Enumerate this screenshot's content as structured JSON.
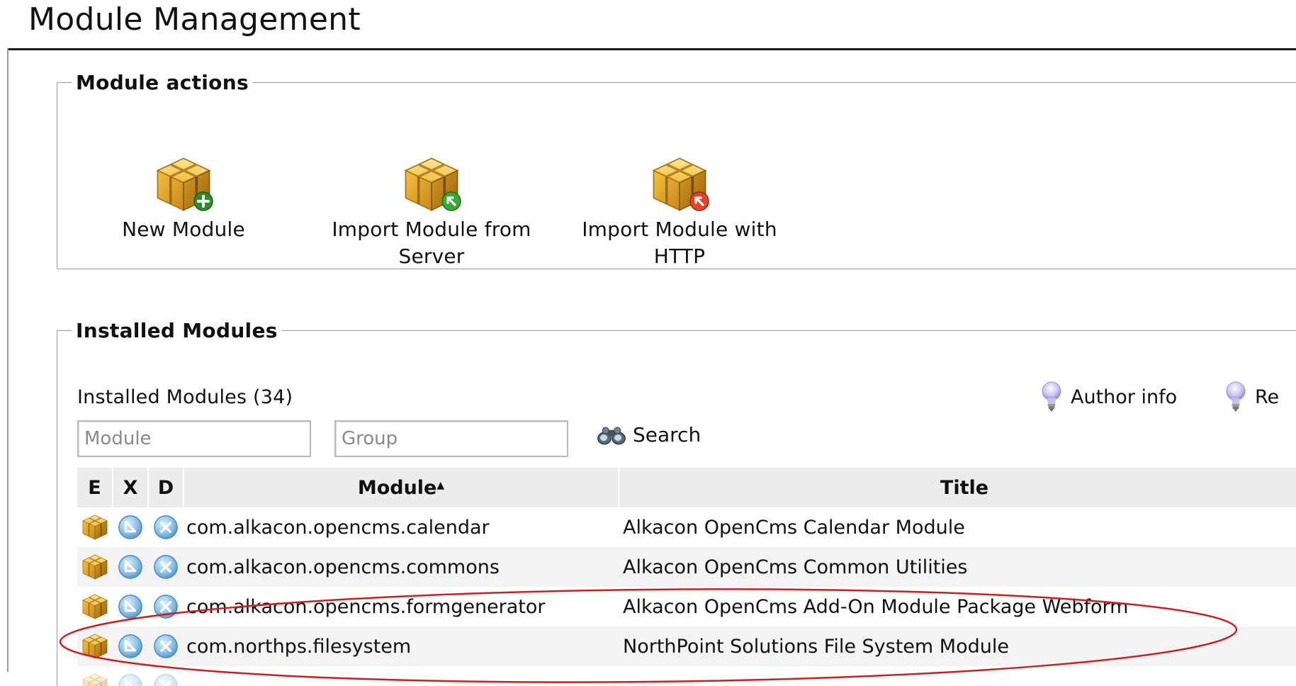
{
  "page": {
    "title": "Module Management"
  },
  "actions_section": {
    "legend": "Module actions",
    "items": [
      {
        "label_line1": "New Module",
        "label_line2": "",
        "badge": "plus",
        "badge_color": "#2e8b2e"
      },
      {
        "label_line1": "Import Module from",
        "label_line2": "Server",
        "badge": "arrow-up-left",
        "badge_color": "#3aa832"
      },
      {
        "label_line1": "Import Module with",
        "label_line2": "HTTP",
        "badge": "arrow-up-left",
        "badge_color": "#e0442a"
      }
    ]
  },
  "installed_section": {
    "legend": "Installed Modules",
    "count_label": "Installed Modules (34)",
    "filters": {
      "module_placeholder": "Module",
      "group_placeholder": "Group",
      "search_label": "Search"
    },
    "info_links": [
      "Author info",
      "Re"
    ],
    "table": {
      "columns": [
        "E",
        "X",
        "D",
        "Module",
        "Title"
      ],
      "sort_indicator": "▲",
      "rows": [
        {
          "module": "com.alkacon.opencms.calendar",
          "title": "Alkacon OpenCms Calendar Module"
        },
        {
          "module": "com.alkacon.opencms.commons",
          "title": "Alkacon OpenCms Common Utilities"
        },
        {
          "module": "com.alkacon.opencms.formgenerator",
          "title": "Alkacon OpenCms Add-On Module Package Webform"
        },
        {
          "module": "com.northps.filesystem",
          "title": "NorthPoint Solutions File System Module"
        }
      ]
    }
  },
  "colors": {
    "annotation": "#cc1f1f",
    "cube": "#e8b028",
    "row_alt": "#f3f3f3",
    "header_bg": "#ececec"
  },
  "icons": {
    "cube": "module-cube-icon",
    "export": "export-circle-icon",
    "delete": "delete-circle-icon",
    "search": "binoculars-icon",
    "info": "lightbulb-icon"
  }
}
